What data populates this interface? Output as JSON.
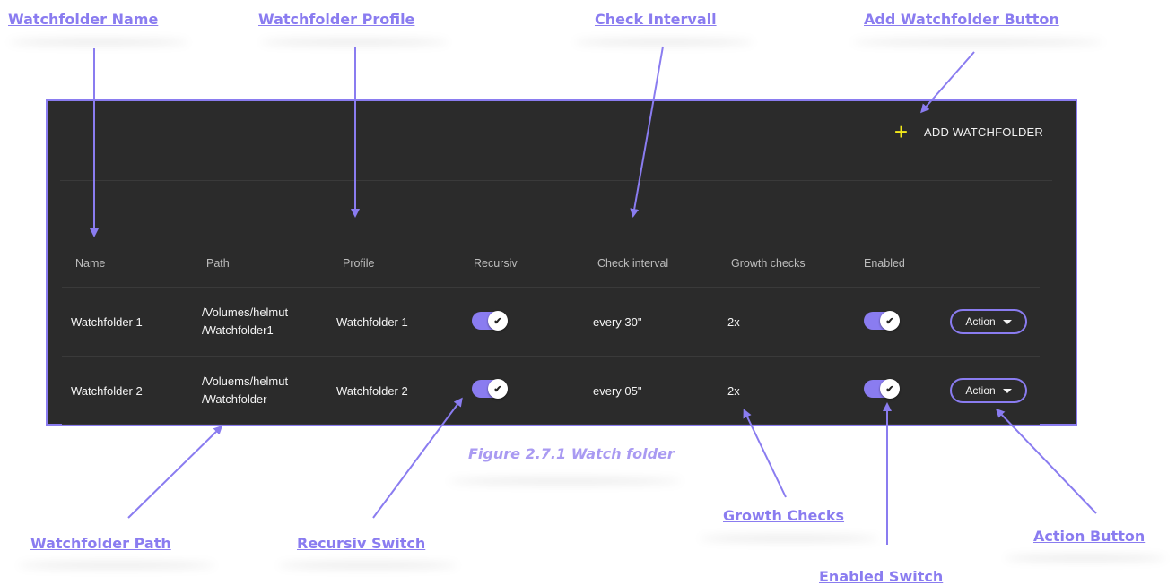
{
  "callouts": {
    "watchfolder_name": "Watchfolder Name",
    "watchfolder_profile": "Watchfolder Profile",
    "check_intervall": "Check Intervall",
    "add_watchfolder_button": "Add Watchfolder Button",
    "watchfolder_path": "Watchfolder Path",
    "recursiv_switch": "Recursiv Switch",
    "growth_checks": "Growth Checks",
    "enabled_switch": "Enabled Switch",
    "action_button": "Action Button"
  },
  "toolbar": {
    "add_label": "ADD WATCHFOLDER",
    "add_icon": "plus-icon"
  },
  "table": {
    "columns": [
      "Name",
      "Path",
      "Profile",
      "Recursiv",
      "Check interval",
      "Growth checks",
      "Enabled"
    ],
    "rows": [
      {
        "name": "Watchfolder 1",
        "path_line1": "/Volumes/helmut",
        "path_line2": "/Watchfolder1",
        "profile": "Watchfolder 1",
        "recursive": true,
        "interval": "every 30\"",
        "growth": "2x",
        "enabled": true,
        "action": "Action"
      },
      {
        "name": "Watchfolder 2",
        "path_line1": "/Voluems/helmut",
        "path_line2": "/Watchfolder",
        "profile": "Watchfolder 2",
        "recursive": true,
        "interval": "every 05\"",
        "growth": "2x",
        "enabled": true,
        "action": "Action"
      }
    ]
  },
  "caption": "Figure 2.7.1 Watch folder",
  "colors": {
    "accent": "#8a7cf0",
    "panel": "#2b2b2b",
    "plus": "#f2e81a"
  }
}
